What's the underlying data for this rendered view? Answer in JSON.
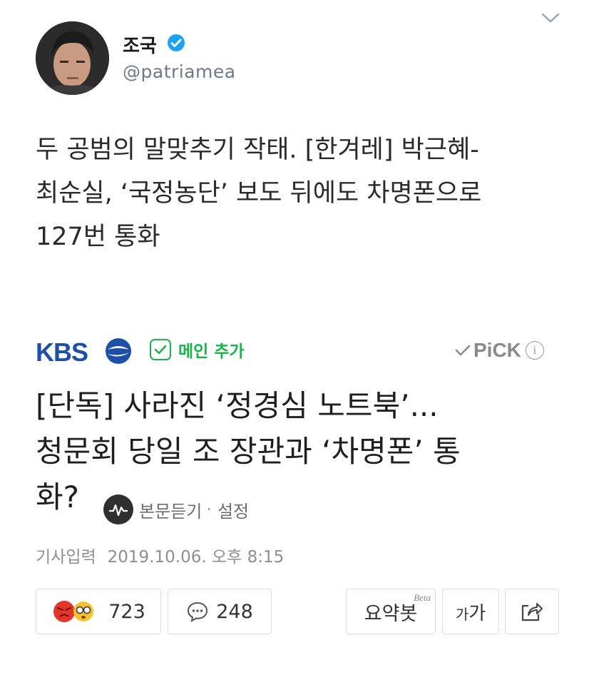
{
  "tweet": {
    "author_name": "조국",
    "handle": "@patriamea",
    "text_lines": [
      "두 공범의 말맞추기 작태. [한겨레] 박근혜-",
      "최순실, ‘국정농단’ 보도 뒤에도 차명폰으로",
      "127번 통화"
    ]
  },
  "article": {
    "press_logo": "KBS",
    "main_add_label": "메인 추가",
    "pick_label": "PiCK",
    "info_label": "i",
    "headline_lines": [
      "[단독] 사라진 ‘정경심 노트북’...",
      "청문회 당일 조 장관과 ‘차명폰’ 통",
      "화?"
    ],
    "listen_label": "본문듣기",
    "separator": "·",
    "settings_label": "설정",
    "timestamp_label": "기사입력",
    "timestamp_value": "2019.10.06. 오후 8:15"
  },
  "actions": {
    "reaction_count": "723",
    "comment_count": "248",
    "summary_label": "요약봇",
    "summary_badge": "Beta",
    "font_small": "가",
    "font_large": "가"
  },
  "colors": {
    "kbs_blue": "#1e4fa8",
    "green_accent": "#19b34a",
    "verified_blue": "#1da1f2"
  }
}
